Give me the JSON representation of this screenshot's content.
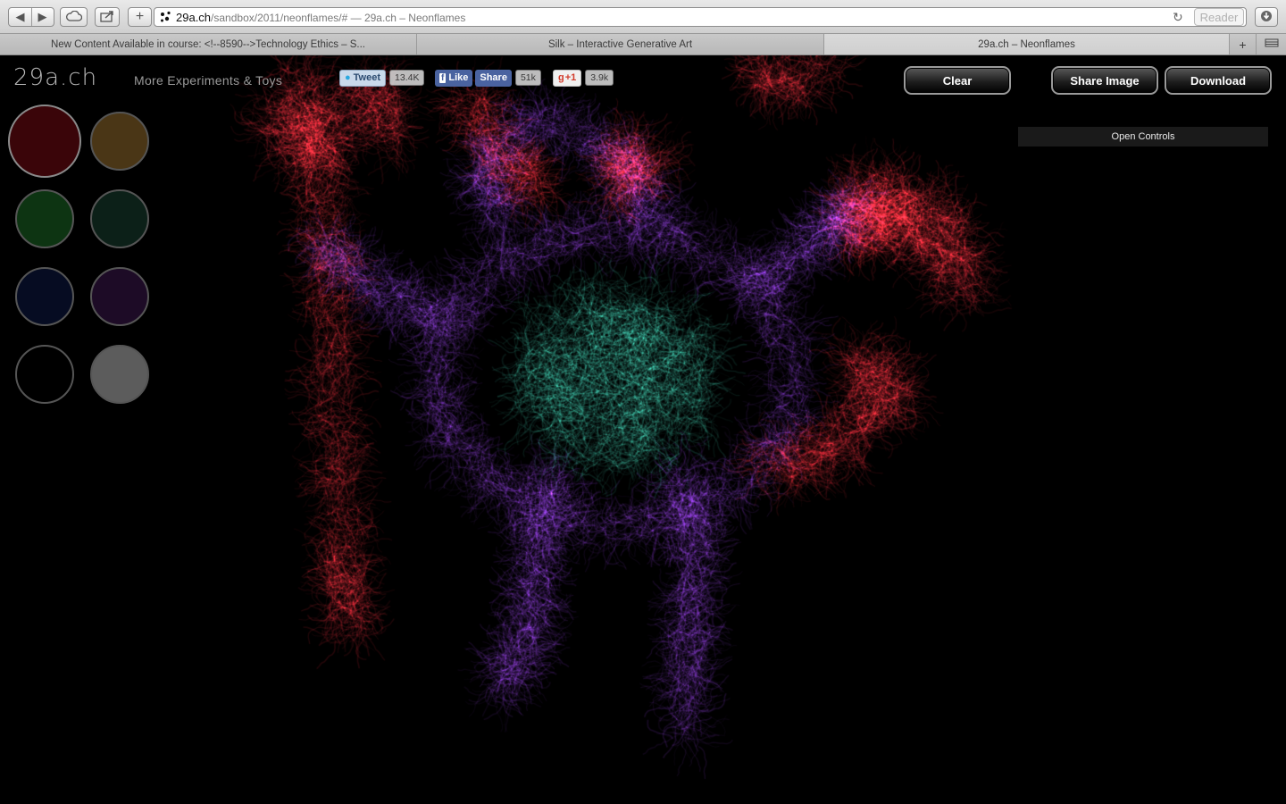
{
  "browser": {
    "url_host": "29a.ch",
    "url_path": "/sandbox/2011/neonflames/# — 29a.ch – Neonflames",
    "reader_label": "Reader",
    "tabs": [
      {
        "label": "New Content Available in course: <!--8590-->Technology Ethics – S..."
      },
      {
        "label": "Silk – Interactive Generative Art"
      },
      {
        "label": "29a.ch – Neonflames"
      }
    ]
  },
  "header": {
    "logo": "29a.ch",
    "more_link": "More Experiments & Toys"
  },
  "social": {
    "tweet_label": "Tweet",
    "tweet_count": "13.4K",
    "like_label": "Like",
    "share_label": "Share",
    "fb_count": "51k",
    "gplus_label": "+1",
    "gplus_count": "3.9k"
  },
  "actions": {
    "clear": "Clear",
    "share_image": "Share Image",
    "download": "Download",
    "open_controls": "Open Controls"
  },
  "palette": [
    {
      "color": "#3a0509",
      "selected": true
    },
    {
      "color": "#4a3616"
    },
    {
      "color": "#0d3412"
    },
    {
      "color": "#0c2018"
    },
    {
      "color": "#060c22"
    },
    {
      "color": "#1d0b26"
    },
    {
      "color": "#000000"
    },
    {
      "color": "#5c5c5c"
    }
  ],
  "colors": {
    "flame_red": "#ff2a3a",
    "flame_purple": "#9a3ef0",
    "flame_teal": "#3fd8b8"
  }
}
